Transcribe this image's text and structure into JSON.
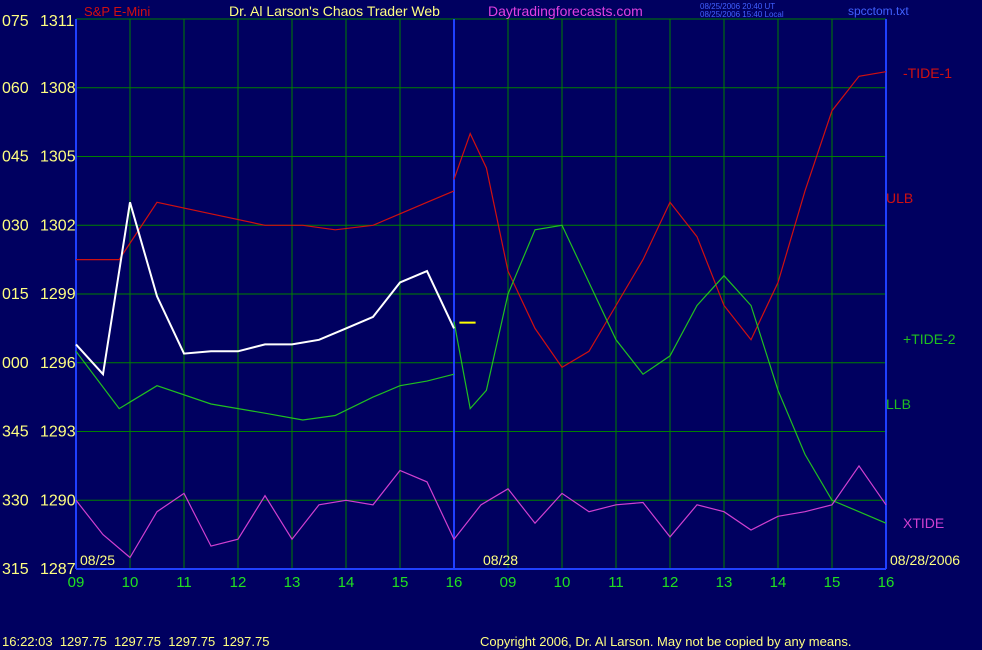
{
  "header": {
    "instrument": "S&P E-Mini",
    "site": "Dr. Al Larson's Chaos Trader Web",
    "url": "Daytradingforecasts.com",
    "timestamp_ut": "08/25/2006 20:40 UT",
    "timestamp_local": "08/25/2006 15:40 Local",
    "filename": "spcctom.txt"
  },
  "footer": {
    "quote": "16:22:03  1297.75  1297.75  1297.75  1297.75",
    "copyright": "Copyright 2006, Dr. Al Larson. May not be copied by any means."
  },
  "date_labels": {
    "start": "08/25",
    "mid": "08/28",
    "end": "08/28/2006"
  },
  "colors": {
    "background": "#000060",
    "grid": "#008000",
    "axis": "#2040ff",
    "label_yellow": "#ffff80",
    "time_green": "#20e020",
    "red_line": "#d01010",
    "green_line": "#20c020",
    "blue_line": "#1010ff",
    "xtide": "#d040d0"
  },
  "chart_data": {
    "type": "line",
    "title": "S&P E-Mini",
    "left_axis_angle": [
      "075",
      "060",
      "045",
      "030",
      "015",
      "000",
      "345",
      "330",
      "315"
    ],
    "left_axis_price": [
      "1311",
      "1308",
      "1305",
      "1302",
      "1299",
      "1296",
      "1293",
      "1290",
      "1287"
    ],
    "x_ticks": [
      "09",
      "10",
      "11",
      "12",
      "13",
      "14",
      "15",
      "16",
      "09",
      "10",
      "11",
      "12",
      "13",
      "14",
      "15",
      "16"
    ],
    "ylim": [
      1287,
      1311
    ],
    "legend": [
      {
        "name": "-TIDE-1",
        "color": "#d01010"
      },
      {
        "name": "ULB",
        "color": "#d01010"
      },
      {
        "name": "+TIDE-2",
        "color": "#20c020"
      },
      {
        "name": "LLB",
        "color": "#20c020"
      },
      {
        "name": "XTIDE",
        "color": "#d040d0"
      }
    ],
    "last_price": 1297.75,
    "price_x": [
      0,
      0.5,
      1,
      1.5,
      2,
      2.5,
      3,
      3.5,
      4,
      4.5,
      5,
      5.5,
      6,
      6.5,
      7
    ],
    "price_series": [
      1296.8,
      1295.5,
      1303.0,
      1298.9,
      1296.4,
      1296.5,
      1296.5,
      1296.8,
      1296.8,
      1297.0,
      1297.5,
      1298.0,
      1299.5,
      1300.0,
      1297.5
    ],
    "series": [
      {
        "name": "-TIDE-1",
        "x": [
          7,
          7.3,
          7.6,
          8.0,
          8.5,
          9.0,
          9.5,
          10.0,
          10.5,
          11.0,
          11.5,
          12.0,
          12.5,
          13.0,
          13.5,
          14.0,
          14.5,
          15.0
        ],
        "y": [
          1304,
          1306,
          1304.5,
          1300,
          1297.5,
          1295.8,
          1296.5,
          1298.5,
          1300.5,
          1303.0,
          1301.5,
          1298.5,
          1297,
          1299.5,
          1303.5,
          1307,
          1308.5,
          1308.7
        ]
      },
      {
        "name": "+TIDE-2",
        "x": [
          7,
          7.3,
          7.6,
          8.0,
          8.5,
          9.0,
          9.5,
          10.0,
          10.5,
          11.0,
          11.5,
          12.0,
          12.5,
          13.0,
          13.5,
          14.0,
          14.5,
          15.0
        ],
        "y": [
          1297.8,
          1294,
          1294.8,
          1299,
          1301.8,
          1302,
          1299.5,
          1297,
          1295.5,
          1296.3,
          1298.5,
          1299.8,
          1298.5,
          1294.8,
          1292,
          1290,
          1289.5,
          1289
        ]
      },
      {
        "name": "ULB",
        "x": [
          0,
          0.8,
          1.5,
          2.5,
          3.5,
          4.2,
          4.8,
          5.5,
          6,
          6.5,
          7
        ],
        "y": [
          1300.5,
          1300.5,
          1303.0,
          1302.5,
          1302.0,
          1302.0,
          1301.8,
          1302.0,
          1302.5,
          1303.0,
          1303.5
        ]
      },
      {
        "name": "LLB",
        "x": [
          0,
          0.8,
          1.5,
          2.5,
          3.5,
          4.2,
          4.8,
          5.5,
          6,
          6.5,
          7
        ],
        "y": [
          1296.5,
          1294.0,
          1295.0,
          1294.2,
          1293.8,
          1293.5,
          1293.7,
          1294.5,
          1295.0,
          1295.2,
          1295.5
        ]
      },
      {
        "name": "XTIDE",
        "x": [
          0,
          0.5,
          1,
          1.5,
          2,
          2.5,
          3,
          3.5,
          4,
          4.5,
          5,
          5.5,
          6,
          6.5,
          7,
          7.5,
          8,
          8.5,
          9,
          9.5,
          10,
          10.5,
          11,
          11.5,
          12,
          12.5,
          13,
          13.5,
          14,
          14.5,
          15
        ],
        "y": [
          1290,
          1288.5,
          1287.5,
          1289.5,
          1290.3,
          1288,
          1288.3,
          1290.2,
          1288.3,
          1289.8,
          1290.0,
          1289.8,
          1291.3,
          1290.8,
          1288.3,
          1289.8,
          1290.5,
          1289,
          1290.3,
          1289.5,
          1289.8,
          1289.9,
          1288.4,
          1289.8,
          1289.5,
          1288.7,
          1289.3,
          1289.5,
          1289.8,
          1291.5,
          1289.8
        ]
      }
    ]
  }
}
